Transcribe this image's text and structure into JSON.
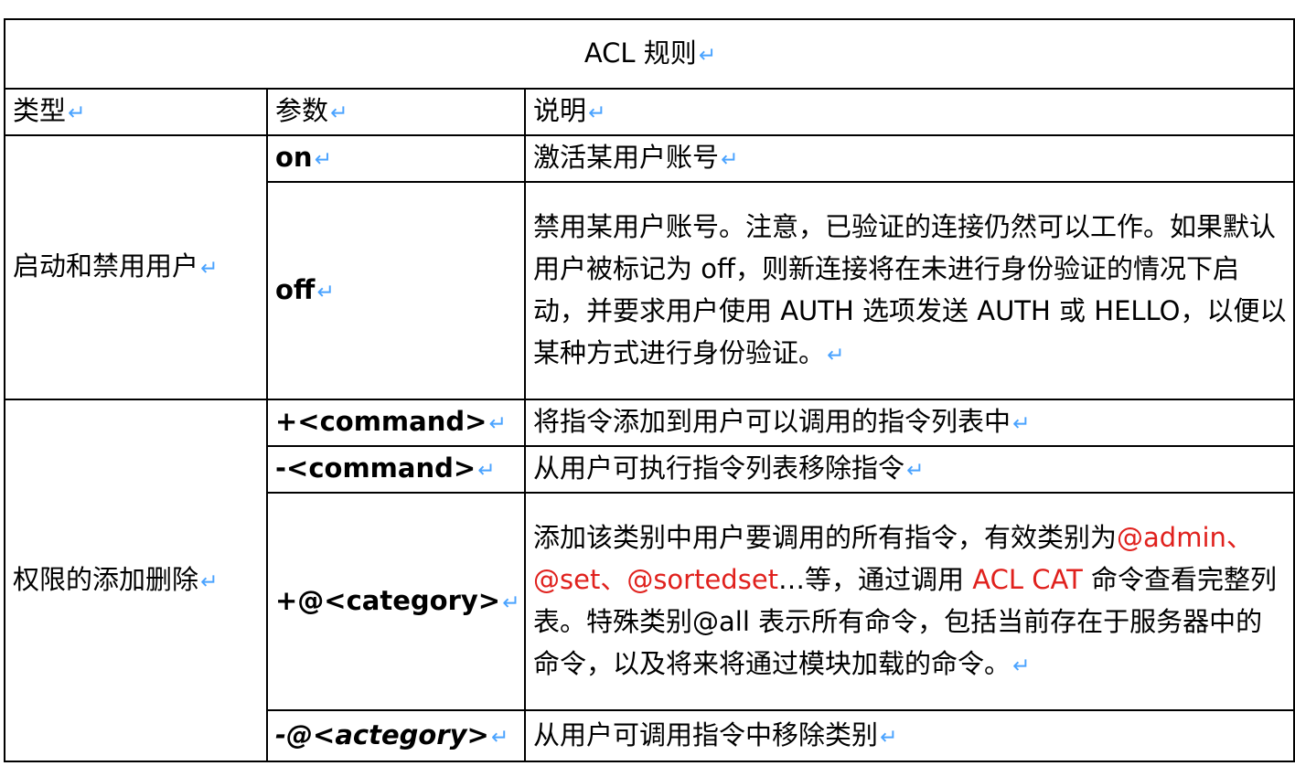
{
  "title": "ACL 规则",
  "return_mark": "↵",
  "headers": {
    "type": "类型",
    "param": "参数",
    "desc": "说明"
  },
  "groups": [
    {
      "type": "启动和禁用用户",
      "rows": [
        {
          "param": "on",
          "desc": "激活某用户账号"
        },
        {
          "param": "off",
          "desc": "禁用某用户账号。注意，已验证的连接仍然可以工作。如果默认用户被标记为 off，则新连接将在未进行身份验证的情况下启动，并要求用户使用 AUTH 选项发送 AUTH 或 HELLO，以便以某种方式进行身份验证。"
        }
      ]
    },
    {
      "type": "权限的添加删除",
      "rows": [
        {
          "param": "+<command>",
          "desc": "将指令添加到用户可以调用的指令列表中"
        },
        {
          "param": "-<command>",
          "desc": "从用户可执行指令列表移除指令"
        },
        {
          "param": "+@<category>",
          "desc_part1": "添加该类别中用户要调用的所有指令，有效类别为",
          "desc_red1": "@admin、@set、@sortedset",
          "desc_part2": "…等，通过调用",
          "desc_red2": "ACL CAT",
          "desc_part3": "命令查看完整列表。特殊类别@all 表示所有命令，包括当前存在于服务器中的命令，以及将来将通过模块加载的命令。"
        },
        {
          "param": "-@<actegory>",
          "desc": "从用户可调用指令中移除类别"
        }
      ]
    }
  ],
  "colors": {
    "accent_red": "#e0211d",
    "return_mark": "#4aa3ff",
    "border": "#000000"
  }
}
